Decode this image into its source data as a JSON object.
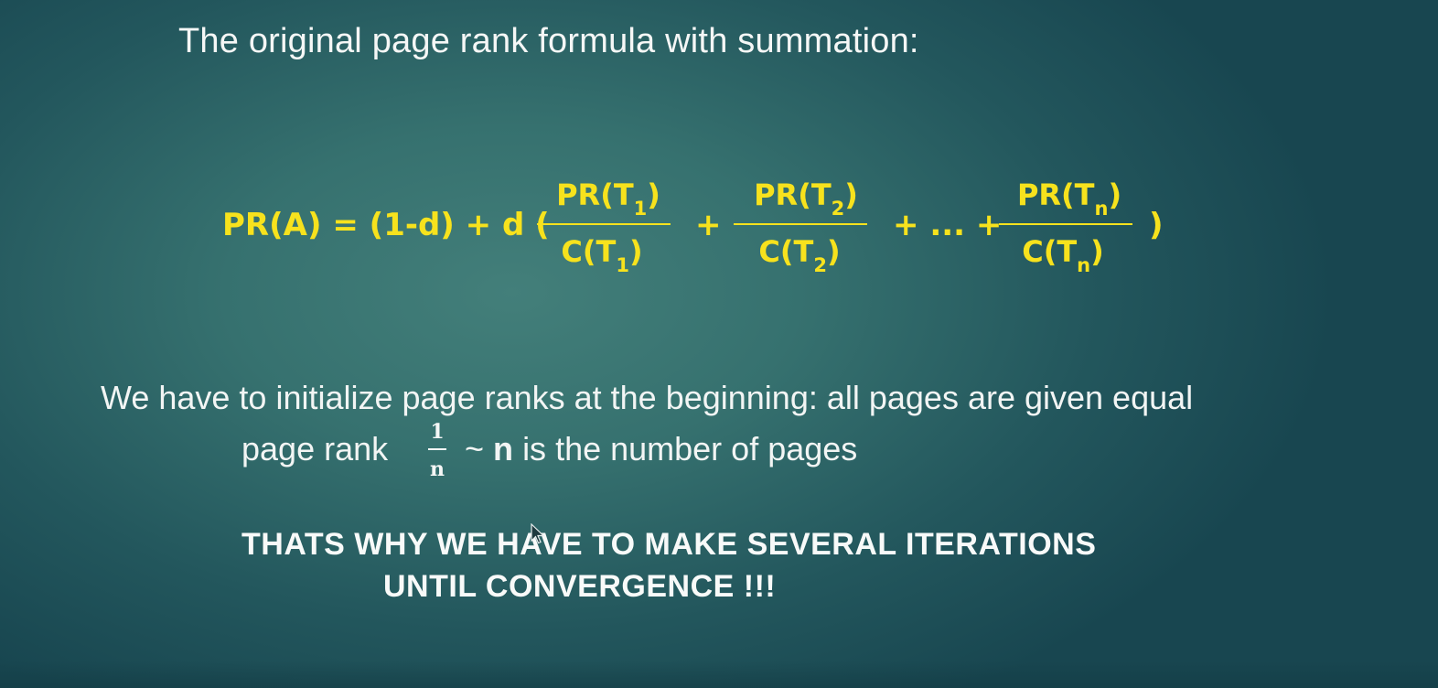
{
  "slide": {
    "title": "The original page rank formula with summation:",
    "formula": {
      "lhs": "PR(A) = (1-d) + d (",
      "fractions": [
        {
          "num_pre": "PR(T",
          "num_sub": "1",
          "num_post": ")",
          "den_pre": "C(T",
          "den_sub": "1",
          "den_post": ")"
        },
        {
          "num_pre": "PR(T",
          "num_sub": "2",
          "num_post": ")",
          "den_pre": "C(T",
          "den_sub": "2",
          "den_post": ")"
        },
        {
          "num_pre": "PR(T",
          "num_sub": "n",
          "num_post": ")",
          "den_pre": "C(T",
          "den_sub": "n",
          "den_post": ")"
        }
      ],
      "plus": "+",
      "plus_ellipsis": "+ ... +",
      "close_paren": ")"
    },
    "init_line1": "We have to initialize page ranks at the beginning: all pages are given equal",
    "init_line2_pre": "page rank",
    "init_frac_num": "1",
    "init_frac_den": "n",
    "init_line2_tilde": "~",
    "init_line2_n": "n",
    "init_line2_post": "is the number of pages",
    "conclusion_line1": "THATS WHY WE HAVE TO MAKE SEVERAL ITERATIONS",
    "conclusion_line2": "UNTIL CONVERGENCE !!!"
  },
  "colors": {
    "formula": "#f7e21d",
    "text": "#f2f5f4",
    "background": "#36716f"
  }
}
